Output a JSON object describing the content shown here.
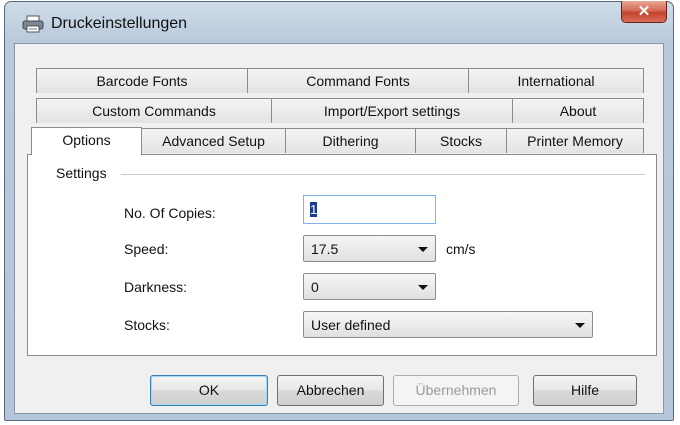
{
  "window": {
    "title": "Druckeinstellungen",
    "close_glyph": "✕",
    "icon": "printer-icon"
  },
  "tabs": {
    "row1": [
      "Barcode Fonts",
      "Command Fonts",
      "International"
    ],
    "row2": [
      "Custom Commands",
      "Import/Export settings",
      "About"
    ],
    "row3": [
      "Options",
      "Advanced Setup",
      "Dithering",
      "Stocks",
      "Printer Memory"
    ],
    "active": "Options"
  },
  "settings": {
    "group_label": "Settings",
    "copies_label": "No. Of Copies:",
    "copies_value": "1",
    "speed_label": "Speed:",
    "speed_value": "17.5",
    "speed_unit": "cm/s",
    "darkness_label": "Darkness:",
    "darkness_value": "0",
    "stocks_label": "Stocks:",
    "stocks_value": "User defined"
  },
  "buttons": {
    "ok": "OK",
    "cancel": "Abbrechen",
    "apply": "Übernehmen",
    "help": "Hilfe"
  },
  "colors": {
    "titlebar": "#b9cadc",
    "close": "#c3412c",
    "focus": "#3c7fb1",
    "text_disabled": "#9a9a9a"
  }
}
